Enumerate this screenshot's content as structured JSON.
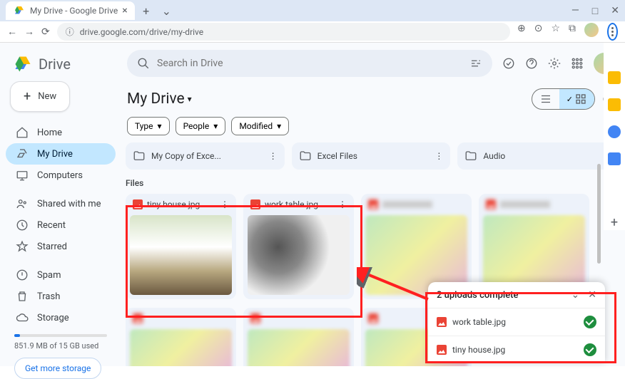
{
  "browser": {
    "tab_title": "My Drive - Google Drive",
    "url": "drive.google.com/drive/my-drive"
  },
  "brand": "Drive",
  "new_button": "New",
  "search_placeholder": "Search in Drive",
  "nav": {
    "home": "Home",
    "mydrive": "My Drive",
    "computers": "Computers",
    "shared": "Shared with me",
    "recent": "Recent",
    "starred": "Starred",
    "spam": "Spam",
    "trash": "Trash",
    "storage": "Storage"
  },
  "storage_text": "851.9 MB of 15 GB used",
  "more_storage": "Get more storage",
  "page_title": "My Drive",
  "filters": {
    "type": "Type",
    "people": "People",
    "modified": "Modified"
  },
  "folders": [
    {
      "name": "My Copy of Exce..."
    },
    {
      "name": "Excel Files"
    },
    {
      "name": "Audio"
    }
  ],
  "files_label": "Files",
  "files": [
    {
      "name": "tiny house.jpg"
    },
    {
      "name": "work table.jpg"
    }
  ],
  "upload": {
    "header": "2 uploads complete",
    "items": [
      "work table.jpg",
      "tiny house.jpg"
    ]
  }
}
